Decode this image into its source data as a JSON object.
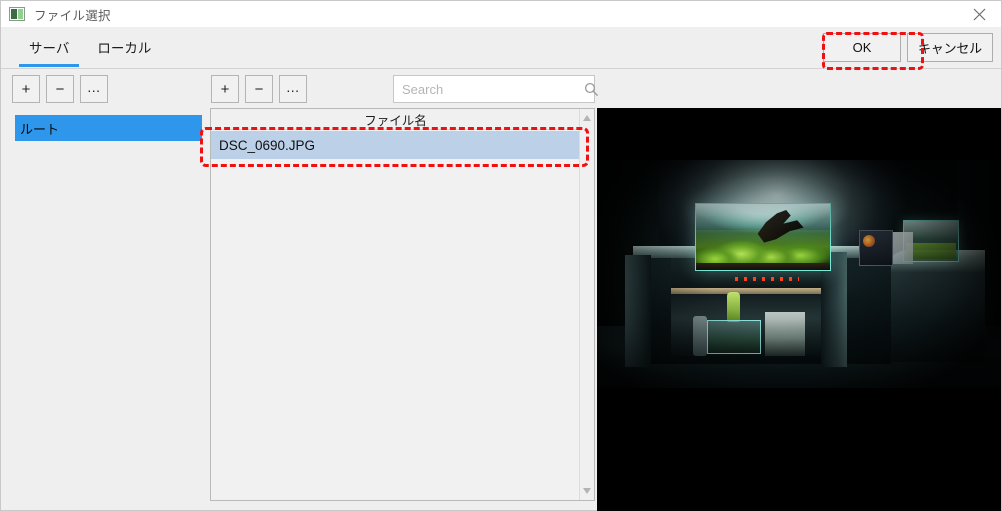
{
  "window": {
    "title": "ファイル選択",
    "icon": "image-file-icon",
    "close_label": "×"
  },
  "tabs": [
    {
      "label": "サーバ",
      "active": true
    },
    {
      "label": "ローカル",
      "active": false
    }
  ],
  "dialog_actions": {
    "ok_label": "OK",
    "cancel_label": "キャンセル"
  },
  "left_toolbar": [
    {
      "label": "+",
      "name": "add-server-button"
    },
    {
      "label": "−",
      "name": "remove-server-button"
    },
    {
      "label": "...",
      "name": "server-options-button"
    }
  ],
  "right_toolbar": [
    {
      "label": "+",
      "name": "add-file-button"
    },
    {
      "label": "−",
      "name": "remove-file-button"
    },
    {
      "label": "...",
      "name": "file-options-button"
    }
  ],
  "search": {
    "placeholder": "Search",
    "value": "",
    "icon": "search-icon"
  },
  "tree": {
    "items": [
      {
        "label": "ルート",
        "selected": true
      }
    ]
  },
  "filelist": {
    "header": "ファイル名",
    "rows": [
      {
        "name": "DSC_0690.JPG",
        "selected": true
      }
    ],
    "scroll_up_icon": "▲",
    "scroll_down_icon": "▼"
  },
  "preview": {
    "alt": "DSC_0690.JPG",
    "background": "#000000"
  },
  "annotations": {
    "accent_color": "#ee1111",
    "items": [
      {
        "target": "ok-button"
      },
      {
        "target": "file-row-dsc-0690"
      }
    ]
  },
  "colors": {
    "tab_accent": "#2e96eb",
    "tree_selection": "#2e96eb",
    "row_selection": "#bcd0e8",
    "window_bg": "#efefef"
  }
}
